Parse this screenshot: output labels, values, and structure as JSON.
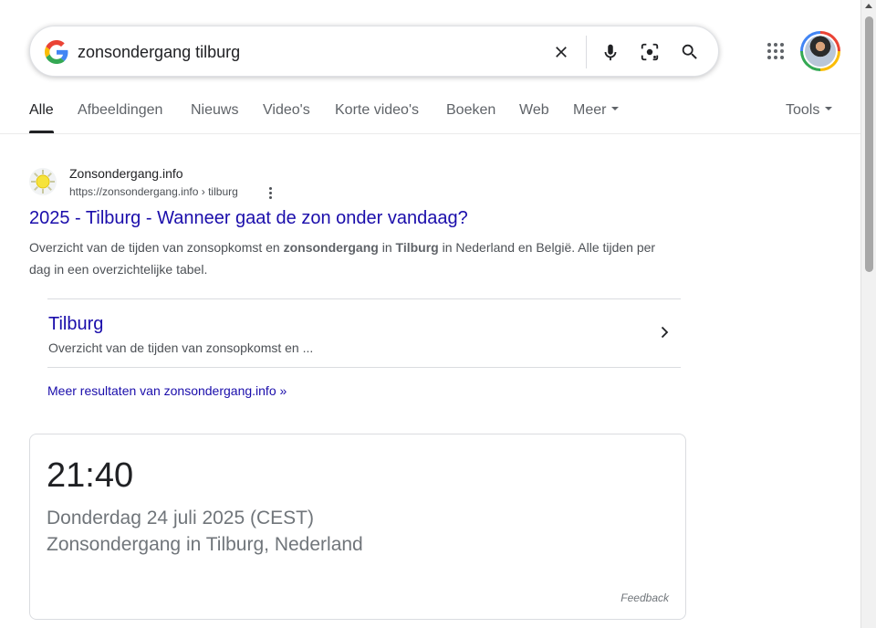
{
  "search": {
    "query": "zonsondergang tilburg",
    "icons": [
      "google-g-icon",
      "clear-icon",
      "microphone-icon",
      "lens-icon",
      "search-icon"
    ]
  },
  "header": {
    "apps_icon": "apps-grid-icon"
  },
  "tabs": [
    {
      "label": "Alle",
      "active": true
    },
    {
      "label": "Afbeeldingen"
    },
    {
      "label": "Nieuws"
    },
    {
      "label": "Video's"
    },
    {
      "label": "Korte video's"
    },
    {
      "label": "Boeken"
    },
    {
      "label": "Web"
    },
    {
      "label": "Meer"
    }
  ],
  "tools_label": "Tools",
  "result": {
    "site_name": "Zonsondergang.info",
    "site_url": "https://zonsondergang.info › tilburg",
    "title": "2025 - Tilburg - Wanneer gaat de zon onder vandaag?",
    "snippet_parts": [
      "Overzicht van de tijden van zonsopkomst en ",
      "zonsondergang",
      " in ",
      "Tilburg",
      " in Nederland en België. Alle tijden per dag in een overzichtelijke tabel."
    ],
    "sitelink": {
      "title": "Tilburg",
      "description": "Overzicht van de tijden van zonsopkomst en ..."
    },
    "more_results": "Meer resultaten van zonsondergang.info »"
  },
  "answer": {
    "time": "21:40",
    "date": "Donderdag 24 juli 2025 (CEST)",
    "place": "Zonsondergang in Tilburg, Nederland",
    "feedback": "Feedback"
  },
  "colors": {
    "link": "#1a0dab",
    "text": "#202124",
    "muted": "#4d5156"
  }
}
